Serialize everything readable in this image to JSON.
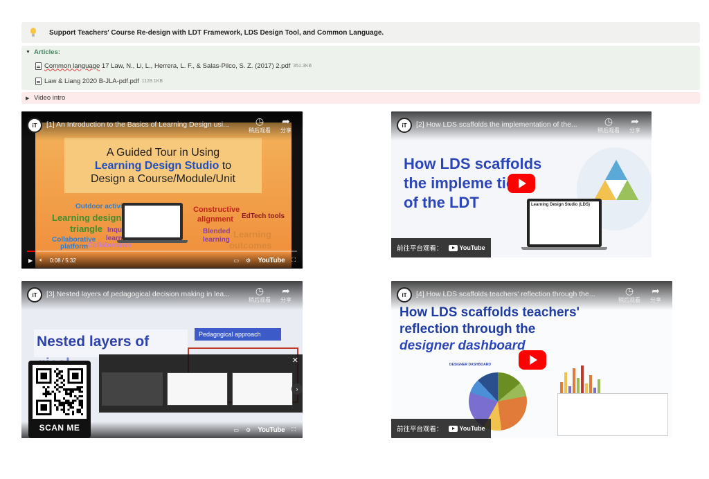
{
  "callout": {
    "text": "Support Teachers' Course Re-design with LDT Framework, LDS Design Tool, and Common Language."
  },
  "articles": {
    "heading": "Articles:",
    "files": [
      {
        "name_a": "Common language",
        "name_b": " 17 Law, N., Li, L., Herrera, L. F., & Salas-Pilco, S. Z. (2017) 2.pdf",
        "size": "351.3KB"
      },
      {
        "name_a": "",
        "name_b": "Law & Liang 2020 B-JLA-pdf.pdf",
        "size": "1128.1KB"
      }
    ]
  },
  "video_intro": {
    "label": "Video intro"
  },
  "videos": [
    {
      "channel": "iT",
      "title": "[1] An Introduction to the Basics of Learning Design usi...",
      "watch_later": "稍后观看",
      "share": "分享",
      "slide_line1": "A Guided Tour in Using",
      "slide_line2": "Learning Design Studio",
      "slide_line2b": " to",
      "slide_line3": "Design a Course/Module/Unit",
      "keywords": [
        "Outdoor activities",
        "Learning design",
        "triangle",
        "Inquiry",
        "learning",
        "Collaborative",
        "platform",
        "Collaborative",
        "Constructive",
        "alignment",
        "EdTech tools",
        "Blended",
        "learning",
        "Learning",
        "outcomes"
      ],
      "time": "0:08 / 5:32",
      "youtube": "YouTube",
      "progress": 0.03
    },
    {
      "channel": "iT",
      "title": "[2] How LDS scaffolds the implementation of the...",
      "watch_later": "稍后观看",
      "share": "分享",
      "big_lines": [
        "How LDS scaffolds",
        "the impleme   tion",
        "of the LDT"
      ],
      "screen_title": "Learning Design Studio (LDS)",
      "watch_on": "前往平台观看：",
      "youtube": "YouTube"
    },
    {
      "channel": "iT",
      "title": "[3] Nested layers of pedagogical decision making in lea...",
      "watch_later": "稍后观看",
      "share": "分享",
      "heading": "Nested layers of",
      "heading2": "gical",
      "peda": "Pedagogical approach",
      "scan": "SCAN ME",
      "youtube": "YouTube"
    },
    {
      "channel": "iT",
      "title": "[4] How LDS scaffolds teachers' reflection through the...",
      "watch_later": "稍后观看",
      "share": "分享",
      "big_line1": "How LDS scaffolds teachers'",
      "big_line2": "reflection through the",
      "big_line3": "designer dashboard",
      "dash_label": "DESIGNER DASHBOARD",
      "watch_on": "前往平台观看：",
      "youtube": "YouTube"
    }
  ],
  "colors": {
    "callout_bg": "#f1f1ef",
    "articles_bg": "#edf3ec",
    "articles_heading": "#448361",
    "video_intro_bg": "#fdebec",
    "youtube_red": "#ff0000",
    "lds_blue": "#2c46b8"
  }
}
